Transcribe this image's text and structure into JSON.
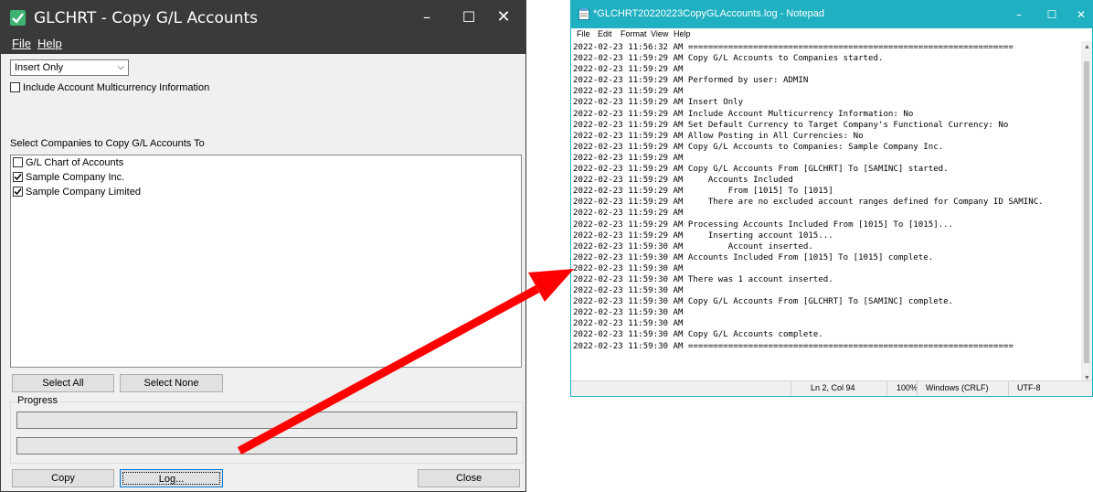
{
  "dialog": {
    "title": "GLCHRT - Copy G/L Accounts",
    "menu": {
      "file_label": "File",
      "help_label": "Help"
    },
    "mode_select": {
      "value": "Insert Only"
    },
    "multicurrency_checkbox": {
      "label": "Include Account Multicurrency Information",
      "checked": false
    },
    "companies_label": "Select Companies to Copy G/L Accounts To",
    "companies": [
      {
        "label": "G/L Chart of Accounts",
        "checked": false
      },
      {
        "label": "Sample Company Inc.",
        "checked": true
      },
      {
        "label": "Sample Company Limited",
        "checked": true
      }
    ],
    "select_all_label": "Select All",
    "select_none_label": "Select None",
    "progress_label": "Progress",
    "copy_label": "Copy",
    "log_label": "Log...",
    "close_label": "Close"
  },
  "notepad": {
    "title": "*GLCHRT20220223CopyGLAccounts.log - Notepad",
    "menu": [
      "File",
      "Edit",
      "Format",
      "View",
      "Help"
    ],
    "lines": [
      "2022-02-23 11:56:32 AM =================================================================",
      "2022-02-23 11:59:29 AM Copy G/L Accounts to Companies started.",
      "2022-02-23 11:59:29 AM",
      "2022-02-23 11:59:29 AM Performed by user: ADMIN",
      "2022-02-23 11:59:29 AM",
      "2022-02-23 11:59:29 AM Insert Only",
      "2022-02-23 11:59:29 AM Include Account Multicurrency Information: No",
      "2022-02-23 11:59:29 AM Set Default Currency to Target Company's Functional Currency: No",
      "2022-02-23 11:59:29 AM Allow Posting in All Currencies: No",
      "2022-02-23 11:59:29 AM Copy G/L Accounts to Companies: Sample Company Inc.",
      "2022-02-23 11:59:29 AM",
      "2022-02-23 11:59:29 AM Copy G/L Accounts From [GLCHRT] To [SAMINC] started.",
      "2022-02-23 11:59:29 AM     Accounts Included",
      "2022-02-23 11:59:29 AM         From [1015] To [1015]",
      "2022-02-23 11:59:29 AM     There are no excluded account ranges defined for Company ID SAMINC.",
      "2022-02-23 11:59:29 AM",
      "2022-02-23 11:59:29 AM Processing Accounts Included From [1015] To [1015]...",
      "2022-02-23 11:59:29 AM     Inserting account 1015...",
      "2022-02-23 11:59:30 AM         Account inserted.",
      "2022-02-23 11:59:30 AM Accounts Included From [1015] To [1015] complete.",
      "2022-02-23 11:59:30 AM",
      "2022-02-23 11:59:30 AM There was 1 account inserted.",
      "2022-02-23 11:59:30 AM",
      "2022-02-23 11:59:30 AM Copy G/L Accounts From [GLCHRT] To [SAMINC] complete.",
      "2022-02-23 11:59:30 AM",
      "2022-02-23 11:59:30 AM",
      "2022-02-23 11:59:30 AM Copy G/L Accounts complete.",
      "2022-02-23 11:59:30 AM ================================================================="
    ],
    "status": {
      "position": "Ln 2, Col 94",
      "zoom": "100%",
      "line_ending": "Windows (CRLF)",
      "encoding": "UTF-8"
    }
  },
  "colors": {
    "dialog_title_bg": "#3a3a3a",
    "notepad_title_bg": "#1fb0c2",
    "arrow": "#ff0000",
    "app_icon": "#3cb371"
  }
}
